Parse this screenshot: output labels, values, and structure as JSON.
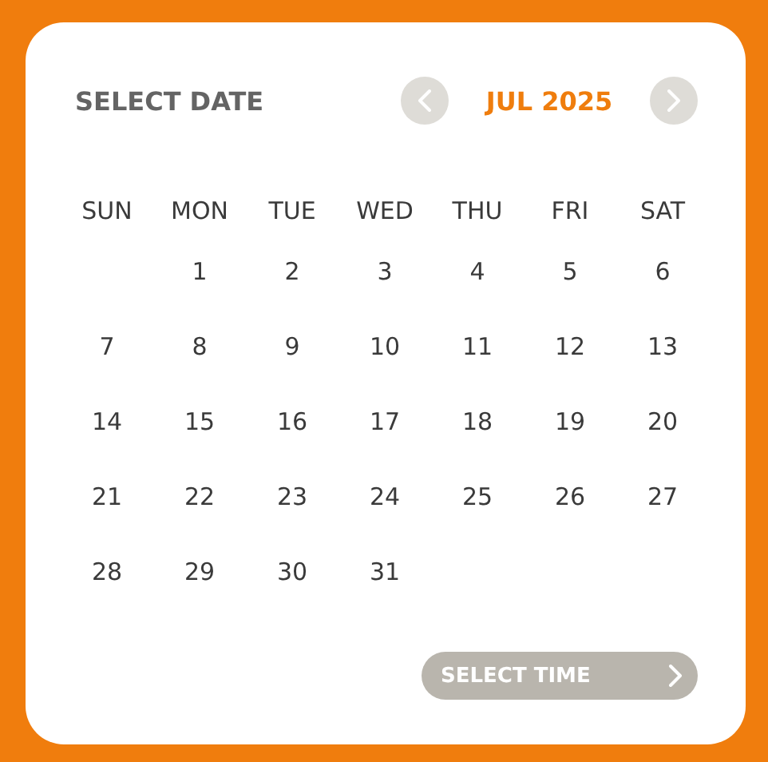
{
  "header": {
    "title": "SELECT DATE",
    "month": "JUL 2025"
  },
  "weekdays": [
    "SUN",
    "MON",
    "TUE",
    "WED",
    "THU",
    "FRI",
    "SAT"
  ],
  "weeks": [
    {
      "kind": "lead",
      "days": [
        "1",
        "2",
        "3",
        "4",
        "5",
        "6"
      ]
    },
    {
      "kind": "full",
      "days": [
        "7",
        "8",
        "9",
        "10",
        "11",
        "12",
        "13"
      ]
    },
    {
      "kind": "full",
      "days": [
        "14",
        "15",
        "16",
        "17",
        "18",
        "19",
        "20"
      ]
    },
    {
      "kind": "full",
      "days": [
        "21",
        "22",
        "23",
        "24",
        "25",
        "26",
        "27"
      ]
    },
    {
      "kind": "tail",
      "days": [
        "28",
        "29",
        "30",
        "31"
      ]
    }
  ],
  "select_time": {
    "label": "SELECT TIME",
    "disabled": true
  }
}
